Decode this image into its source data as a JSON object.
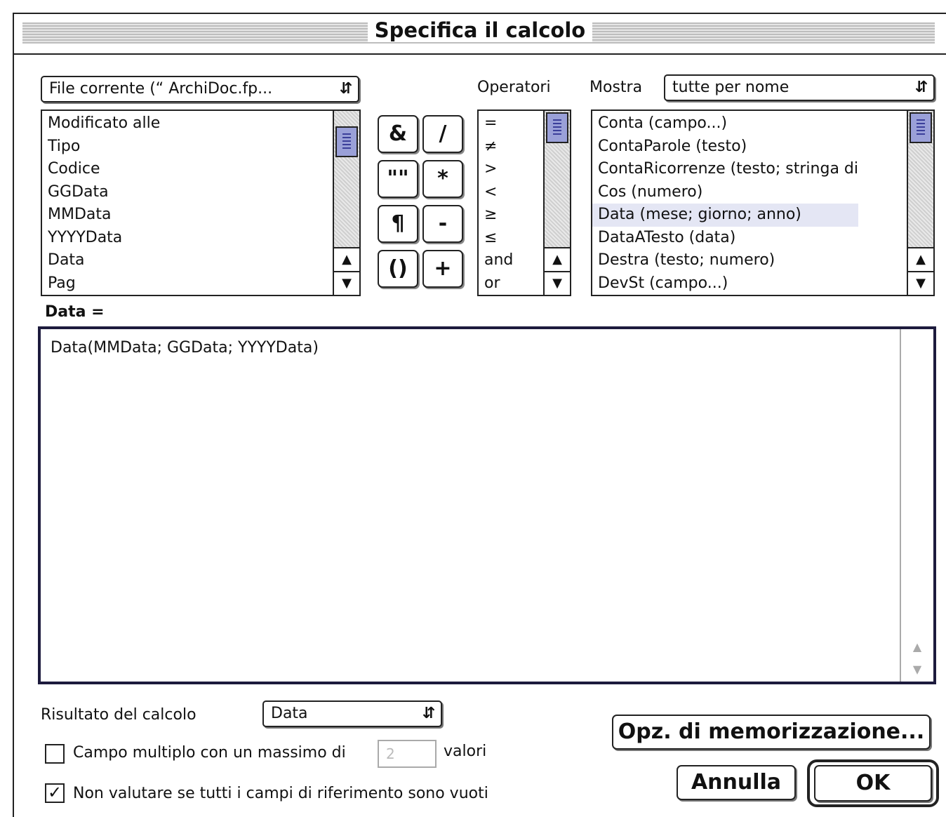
{
  "window": {
    "title": "Specifica il calcolo"
  },
  "file_popup": {
    "value": "File corrente (“ ArchiDoc.fp...",
    "arrows": "↕"
  },
  "fields_list": {
    "items": [
      "Modificato alle",
      "Tipo",
      "Codice",
      "GGData",
      "MMData",
      "YYYYData",
      "Data",
      "Pag"
    ]
  },
  "operator_buttons": [
    "&",
    "/",
    "\"\"",
    "*",
    "¶",
    "-",
    "()",
    "+"
  ],
  "operators": {
    "label": "Operatori",
    "items": [
      "=",
      "≠",
      ">",
      "<",
      "≥",
      "≤",
      "and",
      "or"
    ]
  },
  "mostra": {
    "label": "Mostra",
    "value": "tutte per nome"
  },
  "functions_list": {
    "items": [
      "Conta (campo...)",
      "ContaParole (testo)",
      "ContaRicorrenze (testo; stringa  di",
      "Cos (numero)",
      "Data (mese; giorno; anno)",
      "DataATesto (data)",
      "Destra (testo; numero)",
      "DevSt (campo...)"
    ]
  },
  "formula": {
    "label": "Data =",
    "text": "Data(MMData; GGData; YYYYData)"
  },
  "result": {
    "label": "Risultato del calcolo",
    "value": "Data"
  },
  "repeating": {
    "label": "Campo multiplo con un massimo di",
    "value": "2",
    "suffix": "valori",
    "checked": false
  },
  "no_eval": {
    "label": "Non valutare se tutti i campi di riferimento sono vuoti",
    "checked": true
  },
  "buttons": {
    "storage": "Opz. di memorizzazione...",
    "cancel": "Annulla",
    "ok": "OK"
  },
  "scroll": {
    "up": "▲",
    "down": "▼",
    "check": "✓"
  }
}
